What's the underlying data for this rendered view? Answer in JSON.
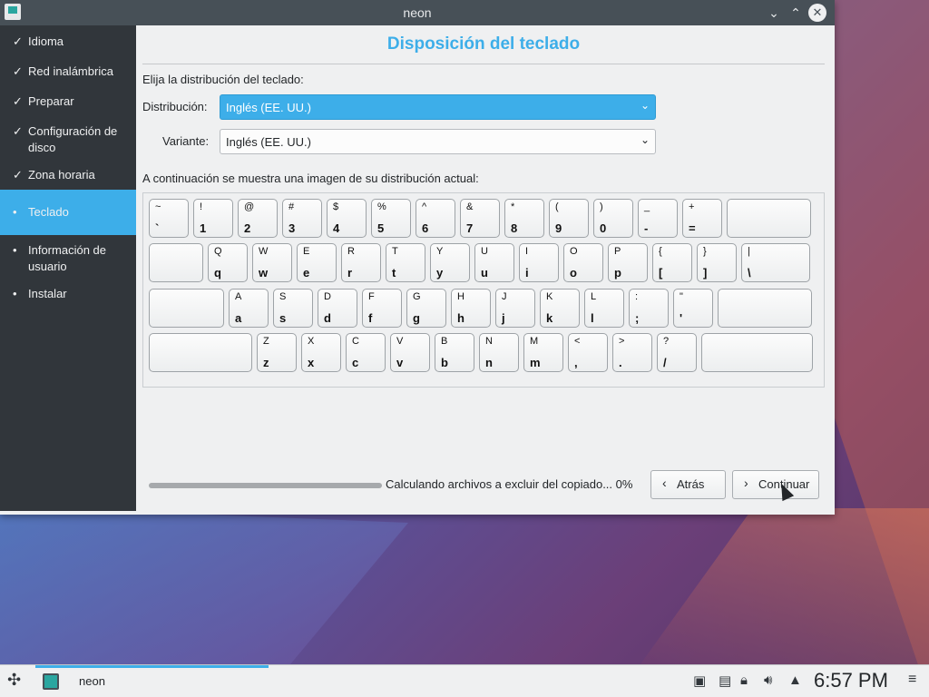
{
  "window": {
    "title": "neon"
  },
  "sidebar": {
    "items": [
      {
        "label": "Idioma",
        "mark": "✓"
      },
      {
        "label": "Red inalámbrica",
        "mark": "✓"
      },
      {
        "label": "Preparar",
        "mark": "✓"
      },
      {
        "label": "Configuración de disco",
        "mark": "✓"
      },
      {
        "label": "Zona horaria",
        "mark": "✓"
      },
      {
        "label": "Teclado",
        "mark": "•"
      },
      {
        "label": "Información de usuario",
        "mark": "•"
      },
      {
        "label": "Instalar",
        "mark": "•"
      }
    ]
  },
  "main": {
    "title": "Disposición del teclado",
    "choose_label": "Elija la distribución del teclado:",
    "layout_label": "Distribución:",
    "layout_value": "Inglés (EE. UU.)",
    "variant_label": "Variante:",
    "variant_value": "Inglés (EE. UU.)",
    "preview_label": "A continuación se muestra una imagen de su distribución actual:"
  },
  "keyboard": {
    "rows": [
      [
        [
          "~",
          "`"
        ],
        [
          "!",
          "1"
        ],
        [
          "@",
          "2"
        ],
        [
          "#",
          "3"
        ],
        [
          "$",
          "4"
        ],
        [
          "%",
          "5"
        ],
        [
          "^",
          "6"
        ],
        [
          "&",
          "7"
        ],
        [
          "*",
          "8"
        ],
        [
          "(",
          "9"
        ],
        [
          ")",
          "0"
        ],
        [
          "_",
          "-"
        ],
        [
          "+",
          "="
        ],
        [
          "",
          ""
        ]
      ],
      [
        [
          "",
          ""
        ],
        [
          "Q",
          "q"
        ],
        [
          "W",
          "w"
        ],
        [
          "E",
          "e"
        ],
        [
          "R",
          "r"
        ],
        [
          "T",
          "t"
        ],
        [
          "Y",
          "y"
        ],
        [
          "U",
          "u"
        ],
        [
          "I",
          "i"
        ],
        [
          "O",
          "o"
        ],
        [
          "P",
          "p"
        ],
        [
          "{",
          "["
        ],
        [
          "}",
          "]"
        ],
        [
          "|",
          "\\"
        ]
      ],
      [
        [
          "",
          ""
        ],
        [
          "A",
          "a"
        ],
        [
          "S",
          "s"
        ],
        [
          "D",
          "d"
        ],
        [
          "F",
          "f"
        ],
        [
          "G",
          "g"
        ],
        [
          "H",
          "h"
        ],
        [
          "J",
          "j"
        ],
        [
          "K",
          "k"
        ],
        [
          "L",
          "l"
        ],
        [
          ":",
          ";"
        ],
        [
          "\"",
          "'"
        ],
        [
          "",
          ""
        ]
      ],
      [
        [
          "",
          ""
        ],
        [
          "Z",
          "z"
        ],
        [
          "X",
          "x"
        ],
        [
          "C",
          "c"
        ],
        [
          "V",
          "v"
        ],
        [
          "B",
          "b"
        ],
        [
          "N",
          "n"
        ],
        [
          "M",
          "m"
        ],
        [
          "<",
          ","
        ],
        [
          ">",
          "."
        ],
        [
          "?",
          "/"
        ],
        [
          "",
          ""
        ]
      ]
    ]
  },
  "footer": {
    "progress": 0,
    "status": "Calculando archivos a excluir del copiado... 0%",
    "back_label": "Atrás",
    "next_label": "Continuar"
  },
  "taskbar": {
    "task_label": "neon",
    "clock": "6:57 PM"
  }
}
